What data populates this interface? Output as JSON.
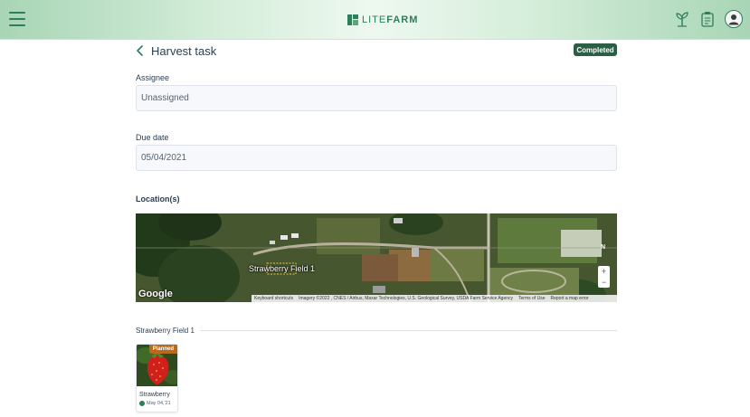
{
  "app": {
    "logo_lite": "LITE",
    "logo_farm": "FARM",
    "brand_color": "#2e7d5b"
  },
  "header": {
    "icons": [
      "menu-icon",
      "sprout-icon",
      "clipboard-icon",
      "profile-icon"
    ]
  },
  "task": {
    "title": "Harvest task",
    "status": "Completed",
    "status_color": "#2a5f45"
  },
  "assignee": {
    "label": "Assignee",
    "value": "Unassigned"
  },
  "due_date": {
    "label": "Due date",
    "value": "05/04/2021"
  },
  "locations": {
    "label": "Location(s)",
    "map": {
      "field_label": "Strawberry Field 1",
      "google": "Google",
      "compass": "N",
      "zoom_in": "+",
      "zoom_out": "−",
      "footer": {
        "shortcuts": "Keyboard shortcuts",
        "imagery": "Imagery ©2022 , CNES / Airbus, Maxar Technologies, U.S. Geological Survey, USDA Farm Service Agency",
        "terms": "Terms of Use",
        "report": "Report a map error"
      }
    }
  },
  "crops_section": {
    "title": "Strawberry Field 1",
    "cards": [
      {
        "name": "Strawberry",
        "status": "Planned",
        "date": "May 04,'21",
        "status_color": "#b86b1a"
      }
    ]
  }
}
